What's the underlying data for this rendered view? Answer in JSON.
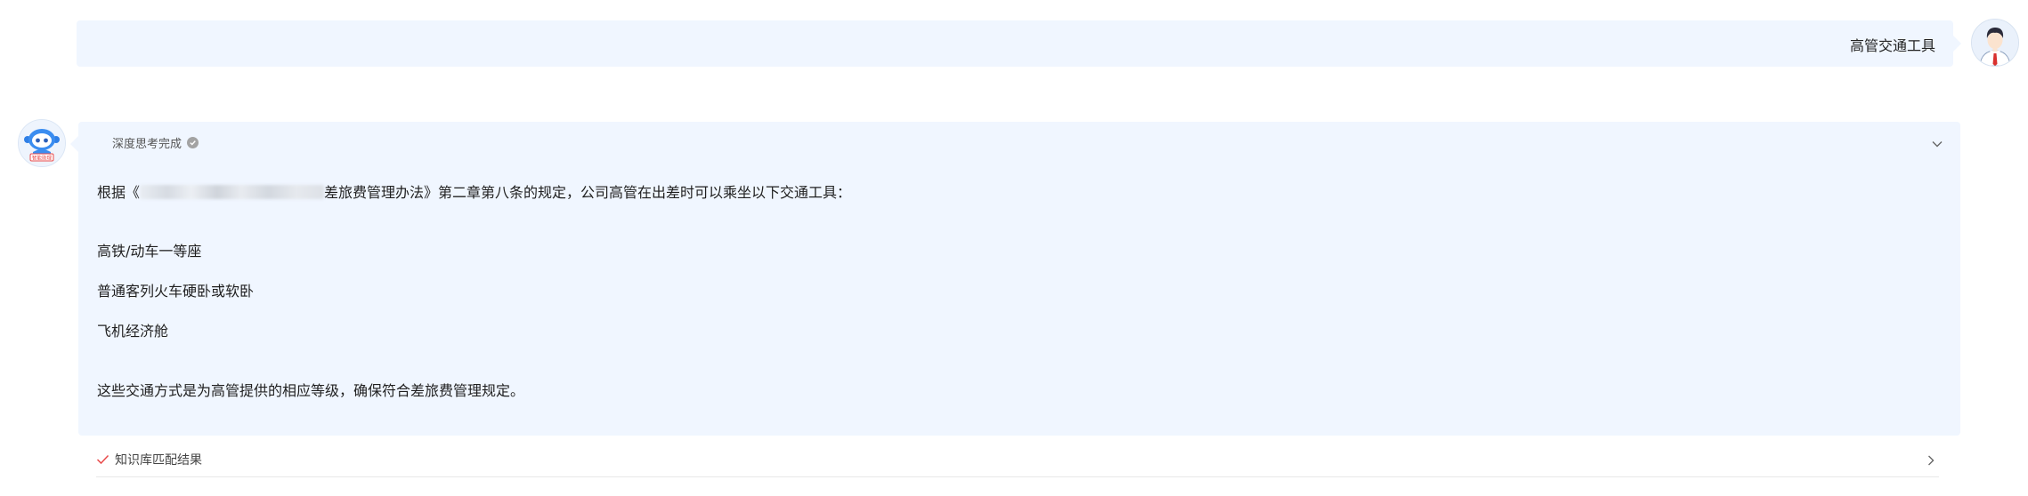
{
  "user_message": {
    "text": "高管交通工具"
  },
  "assistant_message": {
    "thinking_status": "深度思考完成",
    "intro_prefix": "根据《",
    "intro_suffix": "差旅费管理办法》第二章第八条的规定，公司高管在出差时可以乘坐以下交通工具：",
    "items": [
      "高铁/动车一等座",
      "普通客列火车硬卧或软卧",
      "飞机经济舱"
    ],
    "conclusion": "这些交通方式是为高管提供的相应等级，确保符合差旅费管理规定。"
  },
  "bot_avatar": {
    "badge": "智能助理"
  },
  "knowledge_base": {
    "label": "知识库匹配结果"
  },
  "colors": {
    "bubble_bg": "#f0f6ff",
    "accent_red": "#e94b4b",
    "bot_blue": "#3b8df0"
  }
}
